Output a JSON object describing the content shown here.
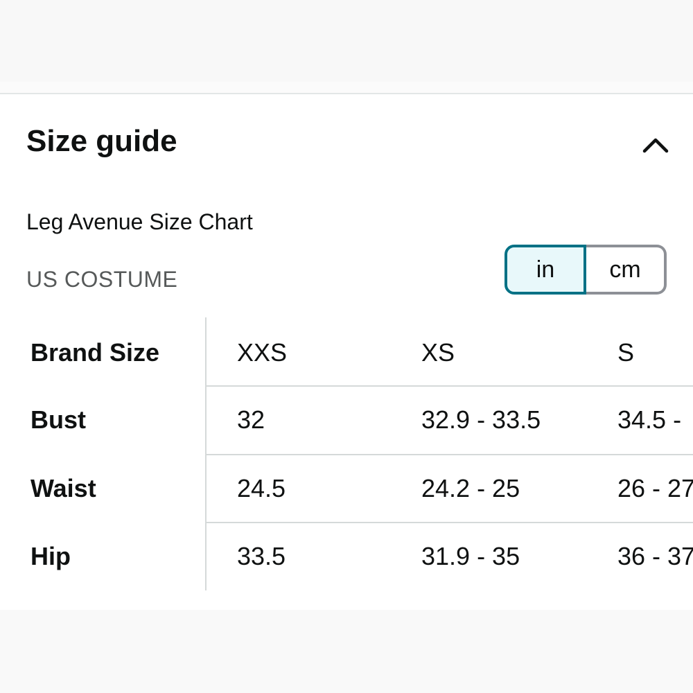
{
  "size_guide": {
    "title": "Size guide",
    "collapse_icon": "chevron-up-icon",
    "chart_name": "Leg Avenue Size Chart",
    "region": "US COSTUME",
    "units": {
      "options": [
        "in",
        "cm"
      ],
      "selected": "in"
    },
    "table": {
      "columns": [
        "Brand Size",
        "XXS",
        "XS",
        "S"
      ],
      "rows": [
        {
          "label": "Bust",
          "values": [
            "32",
            "32.9 - 33.5",
            "34.5 -"
          ]
        },
        {
          "label": "Waist",
          "values": [
            "24.5",
            "24.2 - 25",
            "26 - 27"
          ]
        },
        {
          "label": "Hip",
          "values": [
            "33.5",
            "31.9 - 35",
            "36 - 37"
          ]
        }
      ]
    }
  },
  "colors": {
    "accent": "#007185",
    "selected_bg": "#e8f8fa",
    "secondary_text": "#565959",
    "divider": "#d5d9d9"
  }
}
